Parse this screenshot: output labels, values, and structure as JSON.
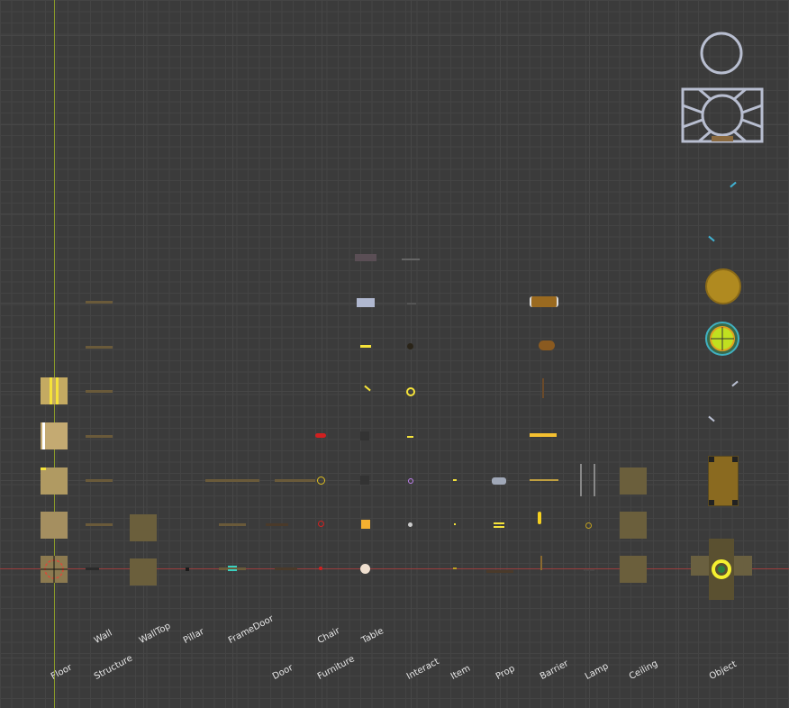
{
  "scene": {
    "columns": {
      "floor": "Floor",
      "wall": "Wall",
      "structure": "Structure",
      "walltop": "WallTop",
      "pillar": "Pillar",
      "framedoor": "FrameDoor",
      "door": "Door",
      "chair": "Chair",
      "furniture": "Furniture",
      "table": "Table",
      "interact": "Interact",
      "item": "Item",
      "prop": "Prop",
      "barrier": "Barrier",
      "lamp": "Lamp",
      "ceiling": "Ceiling",
      "object": "Object"
    },
    "gizmos": [
      "circle-light-gizmo",
      "sun-light-gizmo"
    ]
  },
  "colors": {
    "grid_bg": "#3b3b3b",
    "y_axis": "#8a9a2a",
    "x_axis": "#9a3d3d",
    "highlight": "#f5e33a"
  }
}
